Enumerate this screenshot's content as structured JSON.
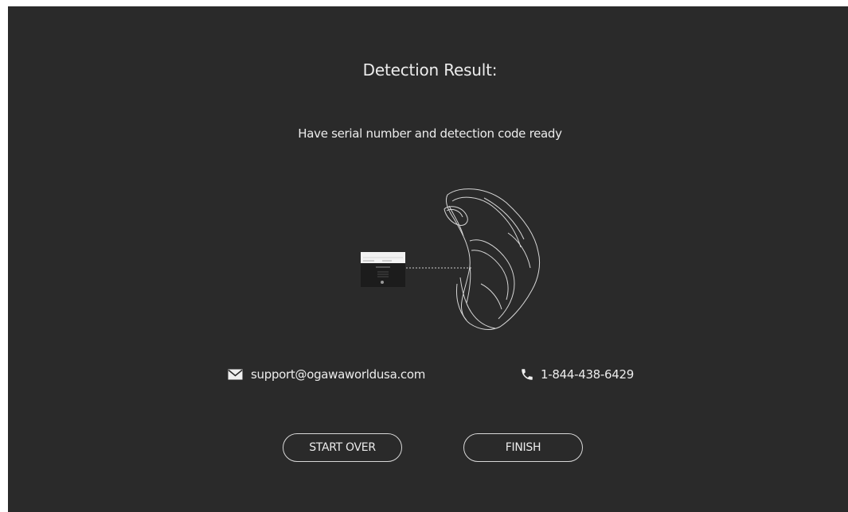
{
  "title": "Detection Result:",
  "subtitle": "Have serial number and detection code ready",
  "contact": {
    "email": "support@ogawaworldusa.com",
    "phone": "1-844-438-6429",
    "email_icon": "envelope-icon",
    "phone_icon": "phone-icon"
  },
  "buttons": {
    "start_over": "START OVER",
    "finish": "FINISH"
  },
  "colors": {
    "background": "#2a2a2a",
    "text": "#ececec",
    "button_border": "#d8d8d8"
  }
}
